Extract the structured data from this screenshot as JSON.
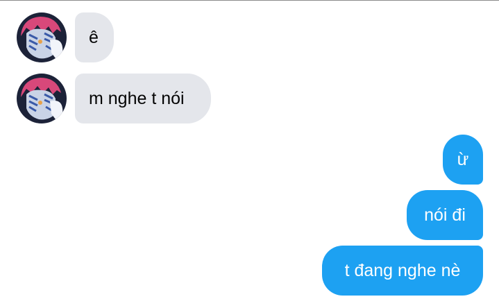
{
  "colors": {
    "incoming_bubble": "#e4e6eb",
    "incoming_text": "#050505",
    "outgoing_bubble": "#1da1f2",
    "outgoing_text": "#ffffff"
  },
  "conversation": {
    "incoming": [
      {
        "text": "ê",
        "avatar_icon": "contact-avatar-icon"
      },
      {
        "text": "m nghe t nói",
        "avatar_icon": "contact-avatar-icon"
      }
    ],
    "outgoing": [
      {
        "text": "ừ"
      },
      {
        "text": "nói đi"
      },
      {
        "text": "t đang nghe nè"
      }
    ]
  }
}
